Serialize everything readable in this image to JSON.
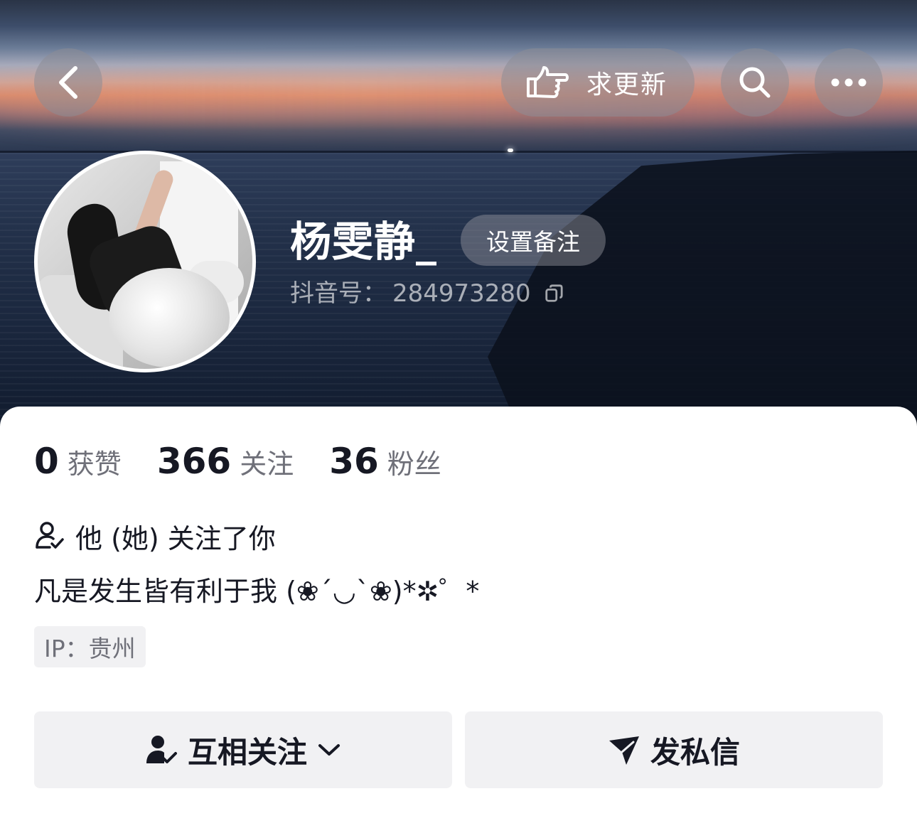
{
  "top_bar": {
    "update_label": "求更新"
  },
  "profile": {
    "username": "杨雯静_",
    "remark_label": "设置备注",
    "douyin_id_label": "抖音号：",
    "douyin_id": "284973280"
  },
  "stats": [
    {
      "value": "0",
      "label": "获赞"
    },
    {
      "value": "366",
      "label": "关注"
    },
    {
      "value": "36",
      "label": "粉丝"
    }
  ],
  "follow_status": "他 (她) 关注了你",
  "bio": "凡是发生皆有利于我 (❀´◡`❀)*✲゜*",
  "ip_location": "IP：贵州",
  "actions": {
    "mutual_follow_label": "互相关注",
    "message_label": "发私信"
  },
  "icons": {
    "back": "chevron-left-icon",
    "update": "pointing-hand-icon",
    "search": "search-icon",
    "more": "more-dots-icon",
    "copy": "copy-icon",
    "user_check": "user-check-icon",
    "dropdown": "chevron-down-icon",
    "send": "send-icon"
  }
}
